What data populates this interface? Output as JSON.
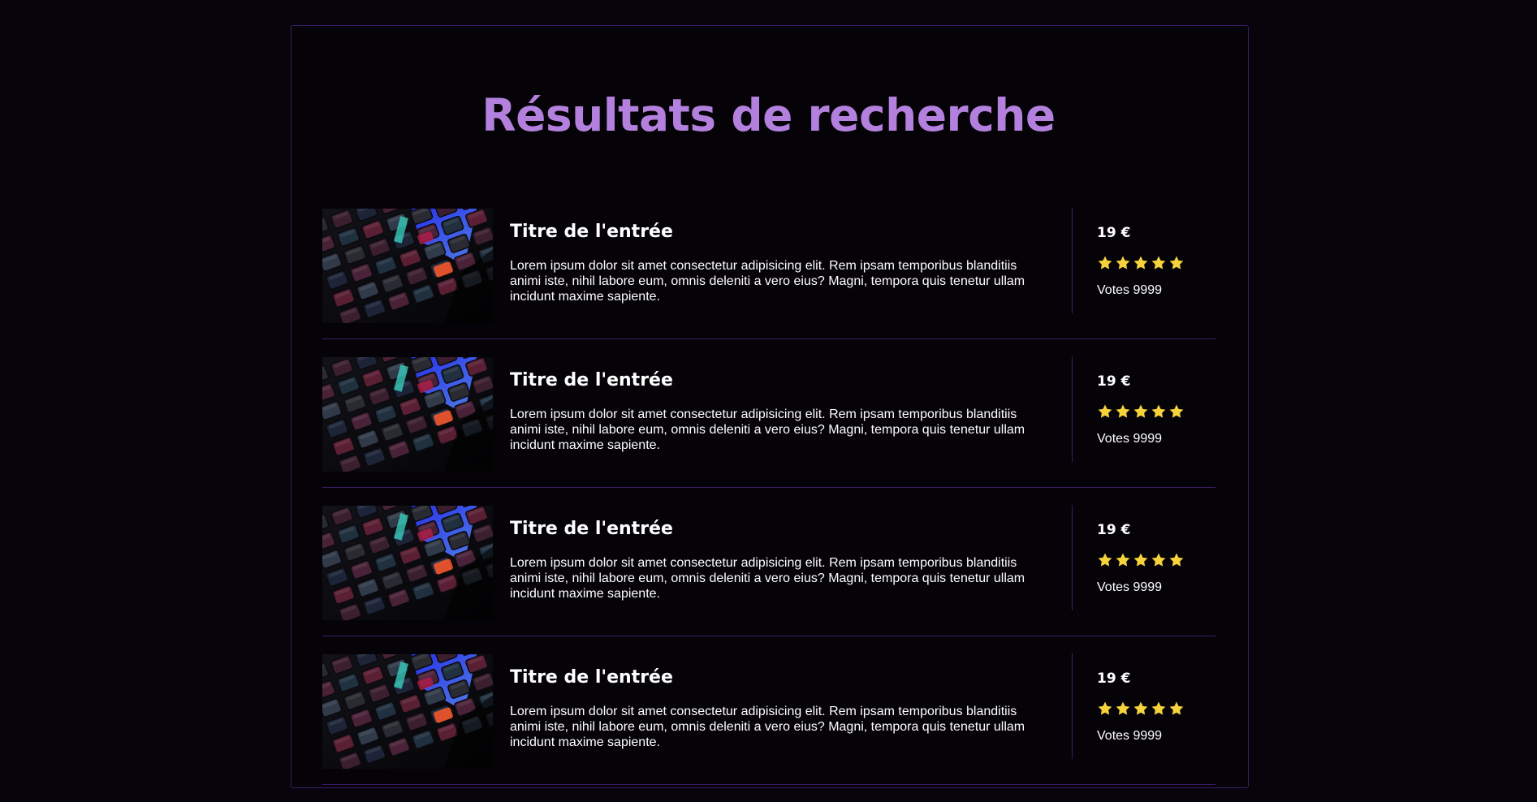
{
  "page": {
    "title": "Résultats de recherche",
    "accent_color": "#b381dd",
    "border_color": "#3a1d66",
    "star_color": "#f6d33b"
  },
  "results": [
    {
      "title": "Titre de l'entrée",
      "description": "Lorem ipsum dolor sit amet consectetur adipisicing elit. Rem ipsam temporibus blanditiis animi iste, nihil labore eum, omnis deleniti a vero eius? Magni, tempora quis tenetur ullam incidunt maxime sapiente.",
      "price": "19 €",
      "rating": 5,
      "rating_max": 5,
      "votes": "Votes 9999",
      "image_icon": "keyboard-photo"
    },
    {
      "title": "Titre de l'entrée",
      "description": "Lorem ipsum dolor sit amet consectetur adipisicing elit. Rem ipsam temporibus blanditiis animi iste, nihil labore eum, omnis deleniti a vero eius? Magni, tempora quis tenetur ullam incidunt maxime sapiente.",
      "price": "19 €",
      "rating": 5,
      "rating_max": 5,
      "votes": "Votes 9999",
      "image_icon": "keyboard-photo"
    },
    {
      "title": "Titre de l'entrée",
      "description": "Lorem ipsum dolor sit amet consectetur adipisicing elit. Rem ipsam temporibus blanditiis animi iste, nihil labore eum, omnis deleniti a vero eius? Magni, tempora quis tenetur ullam incidunt maxime sapiente.",
      "price": "19 €",
      "rating": 5,
      "rating_max": 5,
      "votes": "Votes 9999",
      "image_icon": "keyboard-photo"
    },
    {
      "title": "Titre de l'entrée",
      "description": "Lorem ipsum dolor sit amet consectetur adipisicing elit. Rem ipsam temporibus blanditiis animi iste, nihil labore eum, omnis deleniti a vero eius? Magni, tempora quis tenetur ullam incidunt maxime sapiente.",
      "price": "19 €",
      "rating": 5,
      "rating_max": 5,
      "votes": "Votes 9999",
      "image_icon": "keyboard-photo"
    }
  ]
}
